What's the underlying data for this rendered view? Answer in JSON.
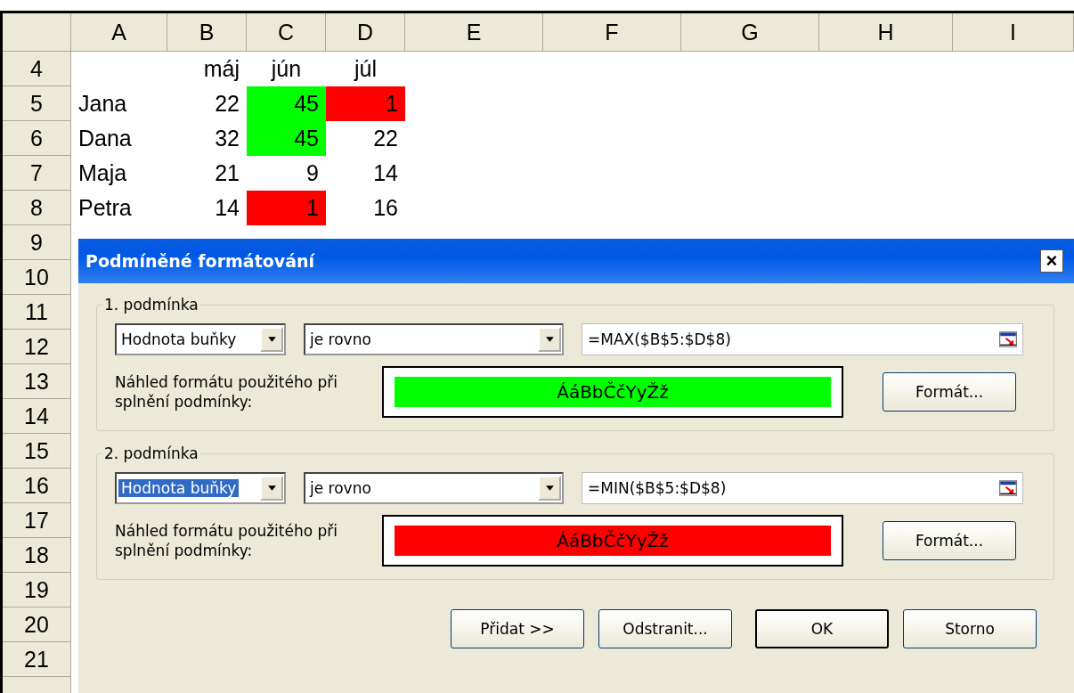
{
  "sheet": {
    "columns": [
      "A",
      "B",
      "C",
      "D",
      "E",
      "F",
      "G",
      "H",
      "I"
    ],
    "rows": [
      {
        "number": "4",
        "cells": [
          null,
          {
            "kind": "number",
            "text": "máj"
          },
          {
            "kind": "heading",
            "text": "jún"
          },
          {
            "kind": "heading",
            "text": "júl"
          }
        ]
      },
      {
        "number": "5",
        "cells": [
          {
            "kind": "text",
            "text": "Jana"
          },
          {
            "kind": "number",
            "text": "22"
          },
          {
            "kind": "number",
            "text": "45",
            "color": "#00ff00"
          },
          {
            "kind": "number",
            "text": "1",
            "color": "#ff0000"
          }
        ]
      },
      {
        "number": "6",
        "cells": [
          {
            "kind": "text",
            "text": "Dana"
          },
          {
            "kind": "number",
            "text": "32"
          },
          {
            "kind": "number",
            "text": "45",
            "color": "#00ff00"
          },
          {
            "kind": "number",
            "text": "22"
          }
        ]
      },
      {
        "number": "7",
        "cells": [
          {
            "kind": "text",
            "text": "Maja"
          },
          {
            "kind": "number",
            "text": "21"
          },
          {
            "kind": "number",
            "text": "9"
          },
          {
            "kind": "number",
            "text": "14"
          }
        ]
      },
      {
        "number": "8",
        "cells": [
          {
            "kind": "text",
            "text": "Petra"
          },
          {
            "kind": "number",
            "text": "14"
          },
          {
            "kind": "number",
            "text": "1",
            "color": "#ff0000"
          },
          {
            "kind": "number",
            "text": "16"
          }
        ]
      },
      {
        "number": "9"
      },
      {
        "number": "10"
      },
      {
        "number": "11"
      },
      {
        "number": "12"
      },
      {
        "number": "13"
      },
      {
        "number": "14"
      },
      {
        "number": "15"
      },
      {
        "number": "16"
      },
      {
        "number": "17"
      },
      {
        "number": "18"
      },
      {
        "number": "19"
      },
      {
        "number": "20"
      },
      {
        "number": "21"
      }
    ]
  },
  "dialog": {
    "title": "Podmíněné formátování",
    "close": "×",
    "conditions": [
      {
        "label": "1. podmínka",
        "type": {
          "value": "Hodnota buňky",
          "focused": false
        },
        "operator": "je rovno",
        "formula": "=MAX($B$5:$D$8)",
        "preview_label": "Náhled formátu použitého při splnění podmínky:",
        "preview_sample": "ÁáBbČčYyŽž",
        "color": "#00ff00",
        "format_button": "Formát..."
      },
      {
        "label": "2. podmínka",
        "type": {
          "value": "Hodnota buňky",
          "focused": true
        },
        "operator": "je rovno",
        "formula": "=MIN($B$5:$D$8)",
        "preview_label": "Náhled formátu použitého při splnění podmínky:",
        "preview_sample": "ÁáBbČčYyŽž",
        "color": "#ff0000",
        "format_button": "Formát..."
      }
    ],
    "buttons": [
      {
        "label": "Přidat >>",
        "default": false
      },
      {
        "label": "Odstranit...",
        "default": false
      },
      {
        "label": "OK",
        "default": true
      },
      {
        "label": "Storno",
        "default": false
      }
    ]
  }
}
